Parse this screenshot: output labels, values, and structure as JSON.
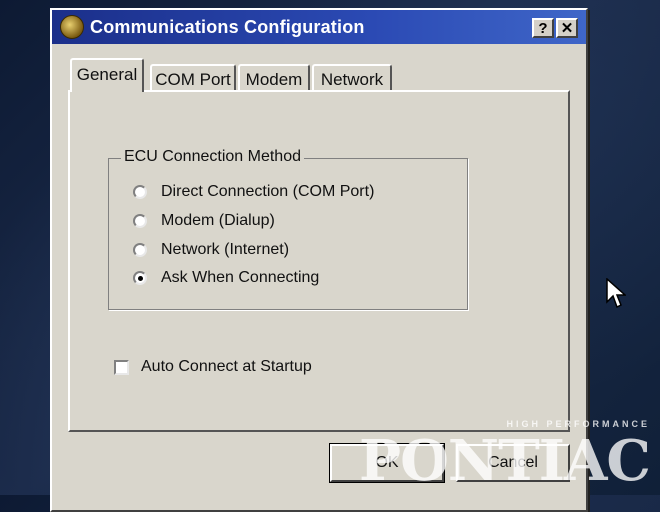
{
  "window": {
    "title": "Communications Configuration",
    "help_button": "?",
    "close_button": "✕"
  },
  "tabs": [
    {
      "label": "General",
      "active": true
    },
    {
      "label": "COM Port",
      "active": false
    },
    {
      "label": "Modem",
      "active": false
    },
    {
      "label": "Network",
      "active": false
    }
  ],
  "connection_group": {
    "legend": "ECU Connection Method",
    "options": [
      {
        "label": "Direct Connection (COM Port)",
        "checked": false
      },
      {
        "label": "Modem (Dialup)",
        "checked": false
      },
      {
        "label": "Network (Internet)",
        "checked": false
      },
      {
        "label": "Ask When Connecting",
        "checked": true
      }
    ]
  },
  "auto_connect": {
    "label": "Auto Connect at Startup",
    "checked": false
  },
  "buttons": {
    "ok": "OK",
    "cancel": "Cancel"
  },
  "watermark": {
    "tagline": "HIGH PERFORMANCE",
    "brand": "PONTIAC"
  }
}
